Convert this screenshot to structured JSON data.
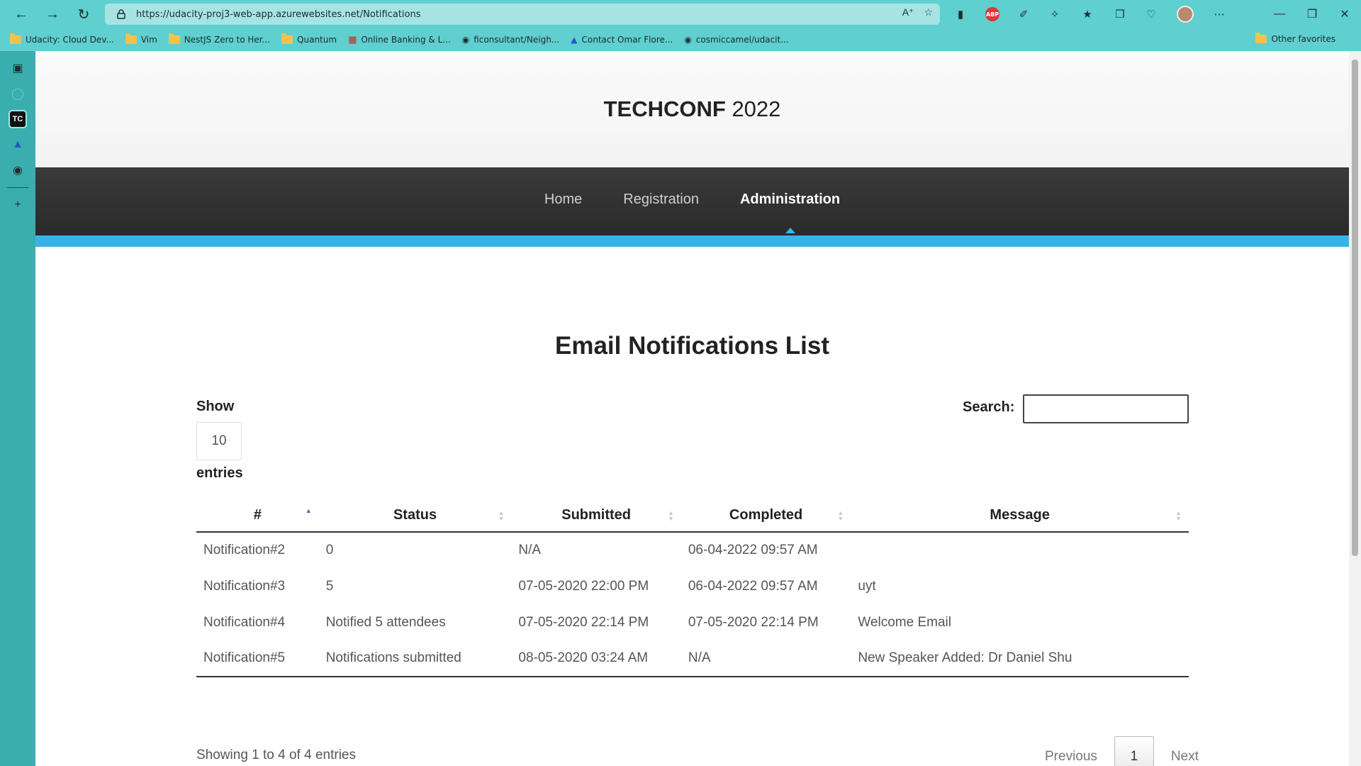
{
  "browser": {
    "url": "https://udacity-proj3-web-app.azurewebsites.net/Notifications",
    "bookmarks": [
      {
        "label": "Udacity: Cloud Dev...",
        "icon": "folder-icon"
      },
      {
        "label": "Vim",
        "icon": "folder-icon"
      },
      {
        "label": "NestJS Zero to Her...",
        "icon": "folder-icon"
      },
      {
        "label": "Quantum",
        "icon": "folder-icon"
      },
      {
        "label": "Online Banking & L...",
        "icon": "bank-icon"
      },
      {
        "label": "ficonsultant/Neigh...",
        "icon": "github-icon"
      },
      {
        "label": "Contact Omar Flore...",
        "icon": "cap-icon"
      },
      {
        "label": "cosmiccamel/udacit...",
        "icon": "github-icon"
      }
    ],
    "other_favorites": "Other favorites",
    "abp_label": "ABP",
    "sidebar_tc": "TC"
  },
  "site": {
    "title_bold": "TECHCONF",
    "title_year": "2022",
    "nav": [
      {
        "label": "Home",
        "active": false
      },
      {
        "label": "Registration",
        "active": false
      },
      {
        "label": "Administration",
        "active": true
      }
    ],
    "accent_color": "#38b3e8"
  },
  "page": {
    "heading": "Email Notifications List",
    "show_label": "Show",
    "page_length": "10",
    "entries_label": "entries",
    "search_label": "Search:",
    "search_value": ""
  },
  "table": {
    "columns": [
      "#",
      "Status",
      "Submitted",
      "Completed",
      "Message"
    ],
    "sorted_column": 0,
    "rows": [
      [
        "Notification#2",
        "0",
        "N/A",
        "06-04-2022 09:57 AM",
        ""
      ],
      [
        "Notification#3",
        "5",
        "07-05-2020 22:00 PM",
        "06-04-2022 09:57 AM",
        "uyt"
      ],
      [
        "Notification#4",
        "Notified 5 attendees",
        "07-05-2020 22:14 PM",
        "07-05-2020 22:14 PM",
        "Welcome Email"
      ],
      [
        "Notification#5",
        "Notifications submitted",
        "08-05-2020 03:24 AM",
        "N/A",
        "New Speaker Added: Dr Daniel Shu"
      ]
    ]
  },
  "footer": {
    "info": "Showing 1 to 4 of 4 entries",
    "previous": "Previous",
    "current_page": "1",
    "next": "Next"
  }
}
